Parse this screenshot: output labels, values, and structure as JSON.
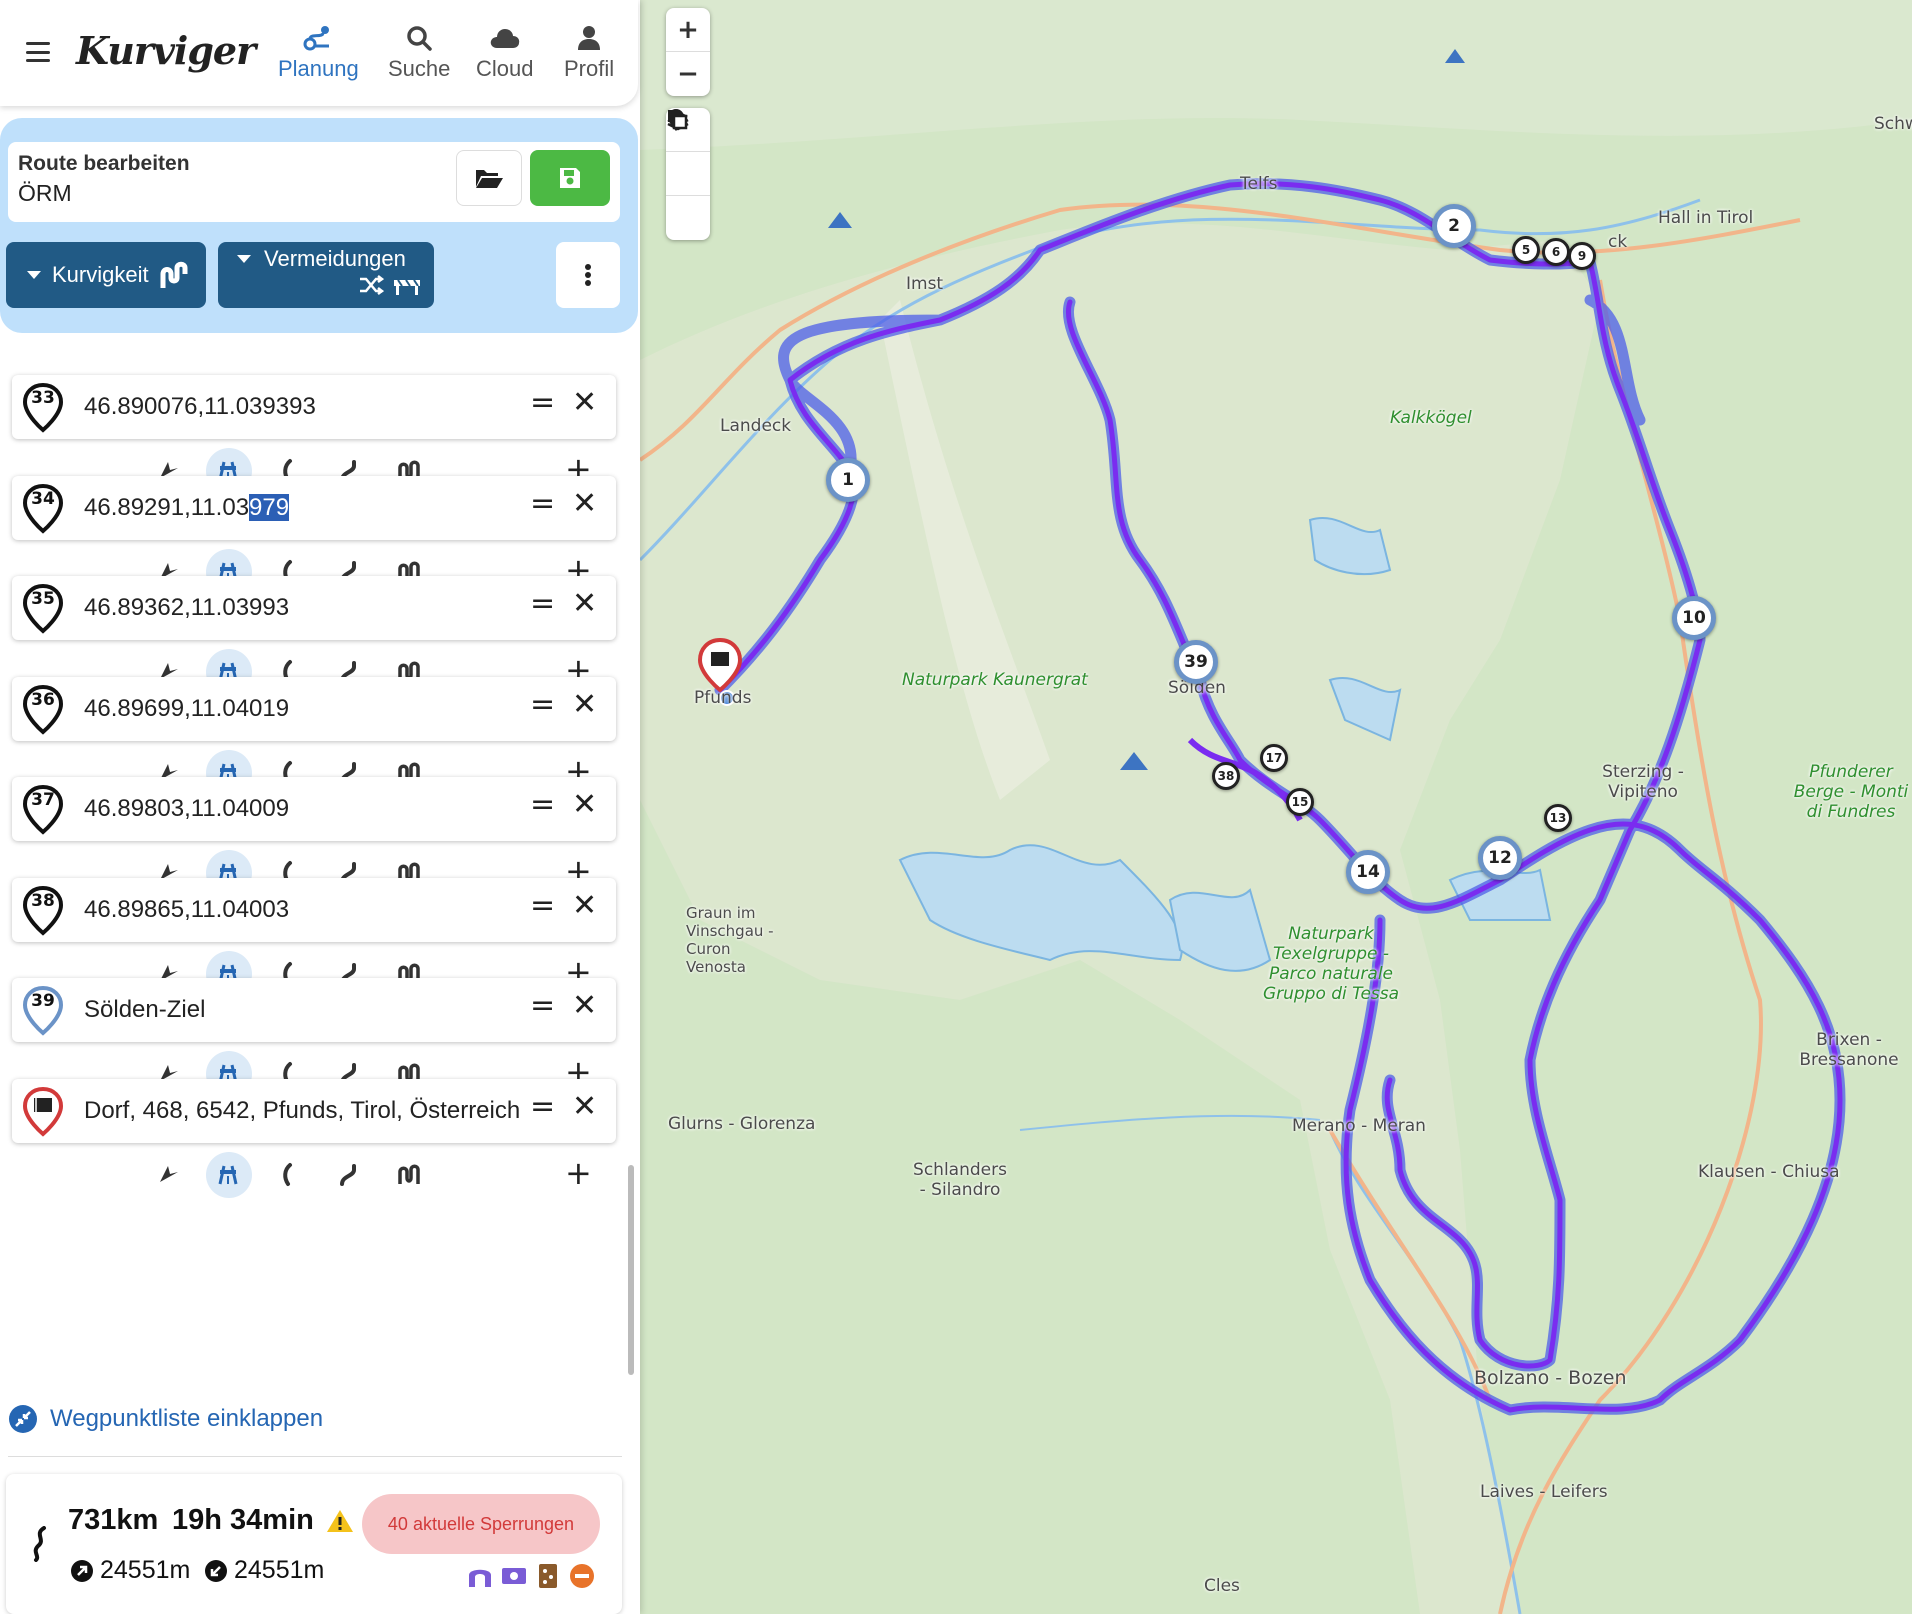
{
  "app": {
    "logo": "Kurviger"
  },
  "nav": [
    {
      "label": "Planung",
      "active": true,
      "icon": "planning-icon"
    },
    {
      "label": "Suche",
      "active": false,
      "icon": "search-icon"
    },
    {
      "label": "Cloud",
      "active": false,
      "icon": "cloud-icon"
    },
    {
      "label": "Profil",
      "active": false,
      "icon": "profile-icon"
    }
  ],
  "edit": {
    "title": "Route bearbeiten",
    "route_name": "ÖRM",
    "curviness_label": "Kurvigkeit",
    "avoid_label": "Vermeidungen"
  },
  "waypoints": [
    {
      "number": "33",
      "text": "46.890076,11.039393"
    },
    {
      "number": "34",
      "text_plain": "46.89291,11.03",
      "text_selected": "979"
    },
    {
      "number": "35",
      "text": "46.89362,11.03993"
    },
    {
      "number": "36",
      "text": "46.89699,11.04019"
    },
    {
      "number": "37",
      "text": "46.89803,11.04009"
    },
    {
      "number": "38",
      "text": "46.89865,11.04003"
    },
    {
      "number": "39",
      "text": "Sölden-Ziel"
    },
    {
      "number": "",
      "text": "Dorf, 468, 6542, Pfunds, Tirol, Österreich"
    }
  ],
  "collapse_label": "Wegpunktliste einklappen",
  "summary": {
    "distance": "731km",
    "duration": "19h 34min",
    "ascent": "24551m",
    "descent": "24551m",
    "closures": "40 aktuelle Sperrungen"
  },
  "map": {
    "places": [
      {
        "name": "Telfs"
      },
      {
        "name": "Hall in Tirol"
      },
      {
        "name": "Imst"
      },
      {
        "name": "Landeck"
      },
      {
        "name": "Kalkkögel"
      },
      {
        "name": "Naturpark Kaunergrat"
      },
      {
        "name": "Sölden"
      },
      {
        "name": "Pfunds"
      },
      {
        "name": "Sterzing - Vipiteno"
      },
      {
        "name": "Pfunderer Berge - Monti di Fundres"
      },
      {
        "name": "Graun im Vinschgau - Curon Venosta"
      },
      {
        "name": "Naturpark Texelgruppe - Parco naturale Gruppo di Tessa"
      },
      {
        "name": "Brixen - Bressanone"
      },
      {
        "name": "Glurns - Glorenza"
      },
      {
        "name": "Merano - Meran"
      },
      {
        "name": "Schlanders - Silandro"
      },
      {
        "name": "Klausen - Chiusa"
      },
      {
        "name": "Bolzano - Bozen"
      },
      {
        "name": "Laives - Leifers"
      },
      {
        "name": "Cles"
      },
      {
        "name": "Schw"
      },
      {
        "name": "ck"
      }
    ],
    "markers": [
      "1",
      "2",
      "5",
      "6",
      "9",
      "10",
      "12",
      "13",
      "14",
      "15",
      "17",
      "38",
      "39"
    ],
    "route_color": "#7a2cf0",
    "accent_color": "#4cb944"
  }
}
